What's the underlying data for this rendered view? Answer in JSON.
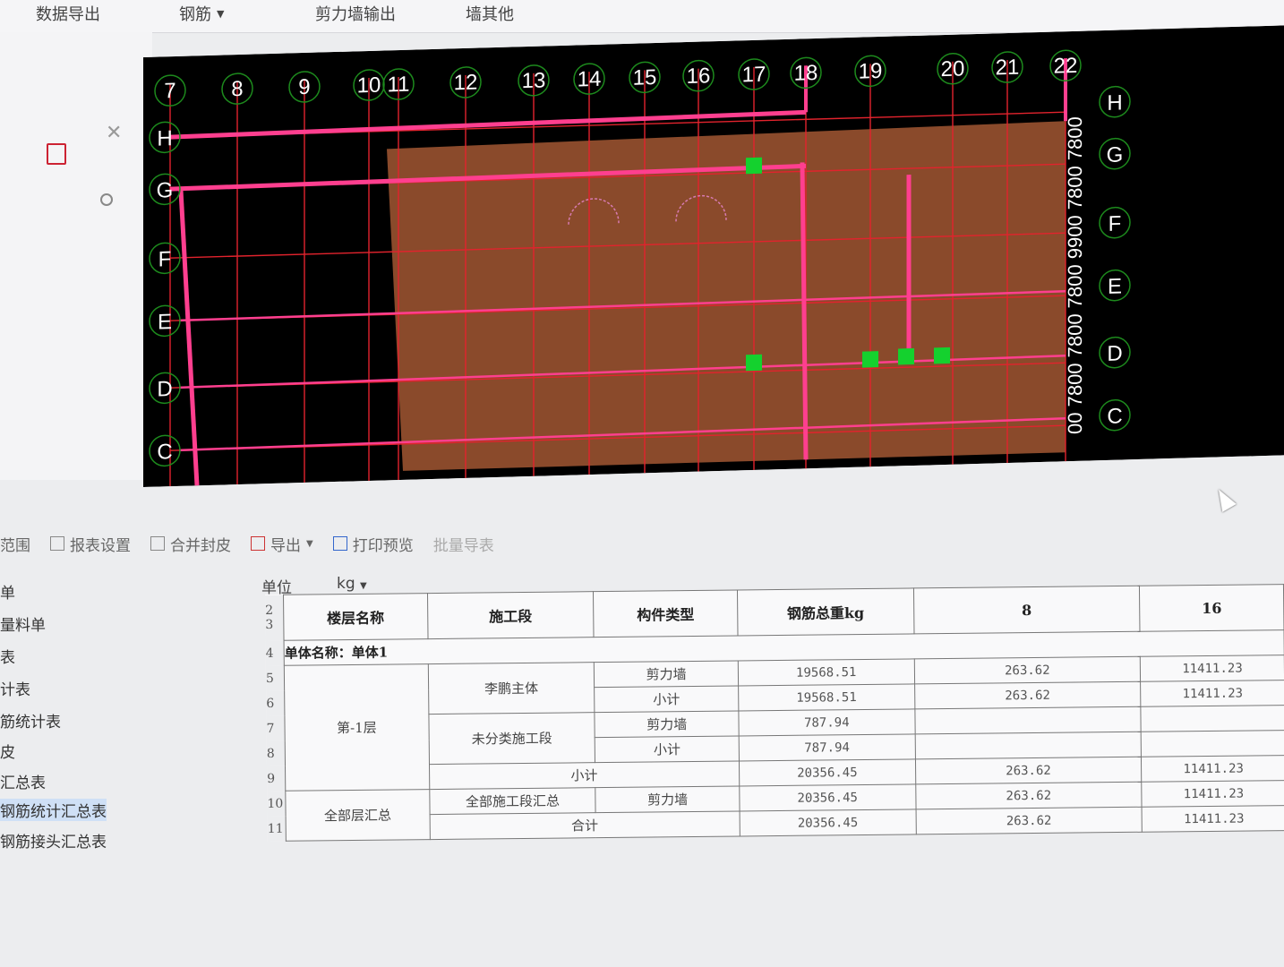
{
  "top_menu": {
    "data_export": "数据导出",
    "rebar": "钢筋",
    "shear_wall_output": "剪力墙输出",
    "other": "墙其他"
  },
  "cad": {
    "col_axes": [
      "7",
      "8",
      "9",
      "10",
      "11",
      "12",
      "13",
      "14",
      "15",
      "16",
      "17",
      "18",
      "19",
      "20",
      "21",
      "22"
    ],
    "row_axes": [
      "H",
      "G",
      "F",
      "E",
      "D",
      "C"
    ],
    "dimension_text": "00 7800 7800 7800 9900 7800 7800",
    "colors": {
      "background": "#000000",
      "beam": "#ff3f8f",
      "grid": "#e2232d",
      "slab": "#8a4a2b",
      "column": "#14d12e",
      "axis_bubble": "#1d8a1d"
    }
  },
  "toolbar": {
    "range": "范围",
    "report_settings": "报表设置",
    "merge_cover": "合并封皮",
    "export": "导出",
    "print_preview": "打印预览",
    "more": "批量导表"
  },
  "left_tree": [
    "单",
    "量料单",
    "表",
    "计表",
    "筋统计表",
    "皮",
    "汇总表",
    "钢筋统计汇总表",
    "钢筋接头汇总表"
  ],
  "unit": {
    "label": "单位",
    "value": "kg"
  },
  "table": {
    "headers": [
      "楼层名称",
      "施工段",
      "构件类型",
      "钢筋总重kg",
      "8",
      "16"
    ],
    "row_numbers": [
      "2",
      "3",
      "4",
      "5",
      "6",
      "7",
      "8",
      "9",
      "10",
      "11"
    ],
    "unit_title": "单体名称：单体1",
    "floor_name": "第-1层",
    "section_1": "李鹏主体",
    "section_2": "未分类施工段",
    "shear_wall": "剪力墙",
    "subtotal": "小计",
    "total_all_floors": "全部层汇总",
    "all_sections": "全部施工段汇总",
    "total": "合计",
    "values": {
      "r5_total": "19568.51",
      "r5_8": "263.62",
      "r5_16": "11411.23",
      "r6_total": "19568.51",
      "r6_8": "263.62",
      "r6_16": "11411.23",
      "r7_total": "787.94",
      "r8_total": "787.94",
      "r9_total": "20356.45",
      "r9_8": "263.62",
      "r9_16": "11411.23",
      "r10_total": "20356.45",
      "r10_8": "263.62",
      "r10_16": "11411.23",
      "r11_total": "20356.45",
      "r11_8": "263.62",
      "r11_16": "11411.23"
    }
  }
}
